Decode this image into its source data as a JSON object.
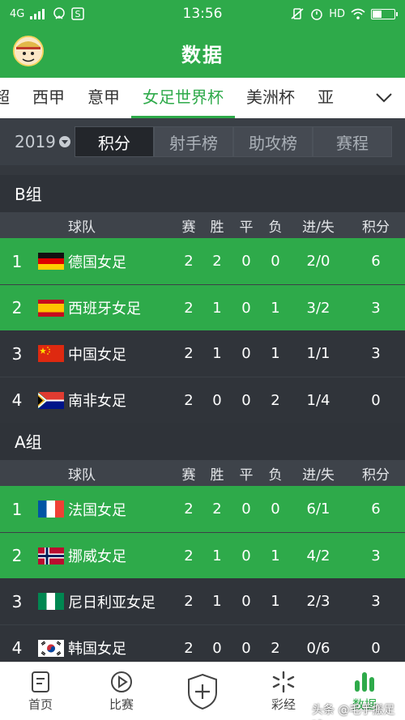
{
  "status": {
    "network": "4G",
    "time": "13:56",
    "hd": "HD"
  },
  "header": {
    "title": "数据"
  },
  "league_tabs": [
    {
      "label": "超",
      "active": false
    },
    {
      "label": "西甲",
      "active": false
    },
    {
      "label": "意甲",
      "active": false
    },
    {
      "label": "女足世界杯",
      "active": true
    },
    {
      "label": "美洲杯",
      "active": false
    },
    {
      "label": "亚",
      "active": false
    }
  ],
  "subbar": {
    "year": "2019",
    "segments": [
      {
        "label": "积分",
        "active": true
      },
      {
        "label": "射手榜",
        "active": false
      },
      {
        "label": "助攻榜",
        "active": false
      },
      {
        "label": "赛程",
        "active": false
      }
    ]
  },
  "table_headers": {
    "team": "球队",
    "played": "赛",
    "won": "胜",
    "drawn": "平",
    "lost": "负",
    "goals": "进/失",
    "points": "积分"
  },
  "groups": [
    {
      "name": "B组",
      "rows": [
        {
          "rank": "1",
          "flag": "germany",
          "team": "德国女足",
          "played": "2",
          "won": "2",
          "drawn": "0",
          "lost": "0",
          "goals": "2/0",
          "points": "6",
          "highlight": true
        },
        {
          "rank": "2",
          "flag": "spain",
          "team": "西班牙女足",
          "played": "2",
          "won": "1",
          "drawn": "0",
          "lost": "1",
          "goals": "3/2",
          "points": "3",
          "highlight": true
        },
        {
          "rank": "3",
          "flag": "china",
          "team": "中国女足",
          "played": "2",
          "won": "1",
          "drawn": "0",
          "lost": "1",
          "goals": "1/1",
          "points": "3",
          "highlight": false
        },
        {
          "rank": "4",
          "flag": "south-africa",
          "team": "南非女足",
          "played": "2",
          "won": "0",
          "drawn": "0",
          "lost": "2",
          "goals": "1/4",
          "points": "0",
          "highlight": false
        }
      ]
    },
    {
      "name": "A组",
      "rows": [
        {
          "rank": "1",
          "flag": "france",
          "team": "法国女足",
          "played": "2",
          "won": "2",
          "drawn": "0",
          "lost": "0",
          "goals": "6/1",
          "points": "6",
          "highlight": true
        },
        {
          "rank": "2",
          "flag": "norway",
          "team": "挪威女足",
          "played": "2",
          "won": "1",
          "drawn": "0",
          "lost": "1",
          "goals": "4/2",
          "points": "3",
          "highlight": true
        },
        {
          "rank": "3",
          "flag": "nigeria",
          "team": "尼日利亚女足",
          "played": "2",
          "won": "1",
          "drawn": "0",
          "lost": "1",
          "goals": "2/3",
          "points": "3",
          "highlight": false
        },
        {
          "rank": "4",
          "flag": "korea",
          "team": "韩国女足",
          "played": "2",
          "won": "0",
          "drawn": "0",
          "lost": "2",
          "goals": "0/6",
          "points": "0",
          "highlight": false
        }
      ]
    }
  ],
  "bottom_nav": [
    {
      "label": "首页",
      "icon": "document-icon",
      "active": false
    },
    {
      "label": "比赛",
      "icon": "play-icon",
      "active": false
    },
    {
      "label": "",
      "icon": "shield-plus-icon",
      "active": false
    },
    {
      "label": "彩经",
      "icon": "pinwheel-icon",
      "active": false
    },
    {
      "label": "数据",
      "icon": "bar-chart-icon",
      "active": true
    }
  ],
  "watermark": "头条 @毛手搬足球",
  "colors": {
    "brand_green": "#2eaa4a",
    "dark_row": "#30343a"
  }
}
